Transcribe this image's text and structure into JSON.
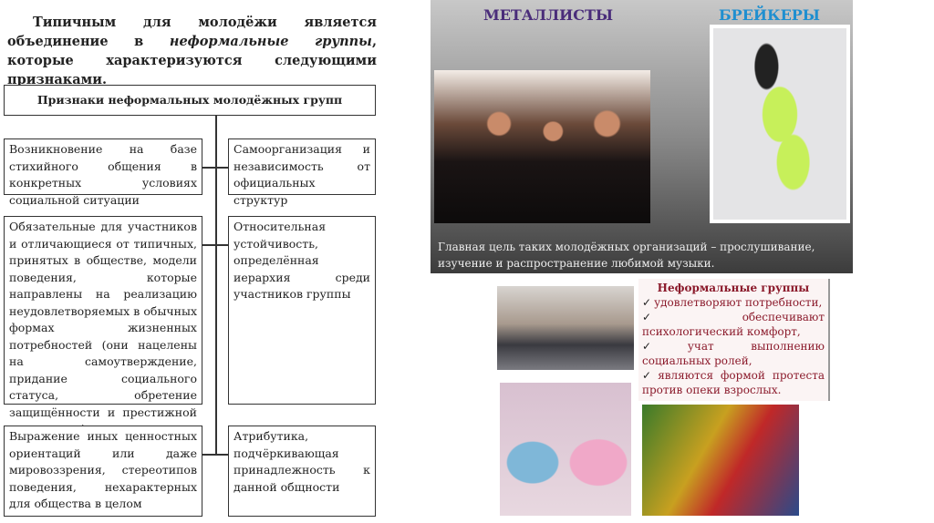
{
  "intro": {
    "part1": "Типичным для молодёжи является объединение в ",
    "italic": "неформальные группы",
    "part2": ", которые характеризуются следующими признаками."
  },
  "diagram": {
    "header": "Признаки неформальных молодёжных групп",
    "left": [
      "Возникновение на базе стихийного общения в конкретных условиях социальной ситуации",
      "Обязательные для участников и отличающиеся от типичных, принятых в обществе, модели поведения, которые направлены на реализацию неудовлетворяемых в обычных формах жизненных потребностей (они нацелены на самоутверждение, придание социального статуса, обретение защищённости и престижной самооценки)",
      "Выражение иных ценностных ориентаций или даже мировоззрения, стереотипов поведения, нехарактерных для общества в целом"
    ],
    "right": [
      "Самоорганизация и независимость от официальных структур",
      "Относительная устойчивость, определённая иерархия среди участников группы",
      "Атрибутика, подчёркивающая принадлежность к данной общности"
    ]
  },
  "panel": {
    "title_metal": "МЕТАЛЛИСТЫ",
    "title_break": "БРЕЙКЕРЫ",
    "caption": "Главная цель таких молодёжных организаций – прослушивание, изучение и распространение любимой музыки.",
    "metal_color": "#4a2d7a",
    "break_color": "#1f8fd0"
  },
  "groups": {
    "title": "Неформальные группы",
    "items": [
      "удовлетворяют потребности,",
      "обеспечивают психологический комфорт,",
      "учат выполнению социальных ролей,",
      "являются формой протеста против опеки взрослых."
    ],
    "check": "✓"
  }
}
